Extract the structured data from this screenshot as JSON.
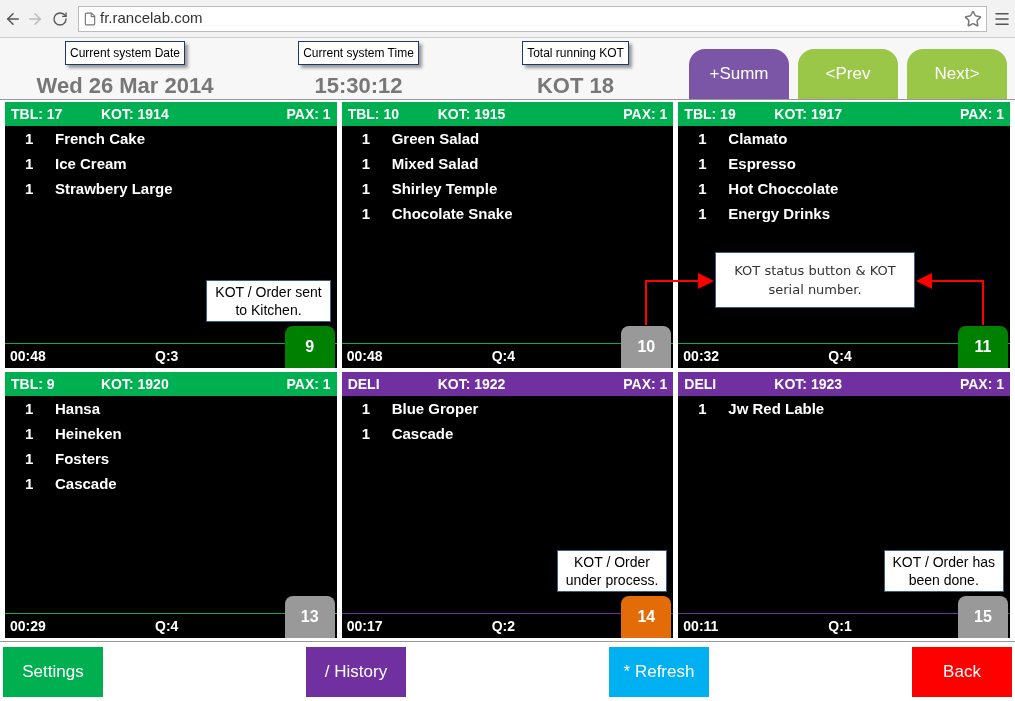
{
  "browser": {
    "url": "fr.rancelab.com"
  },
  "info": [
    {
      "label": "Current system Date",
      "value": "Wed 26 Mar 2014"
    },
    {
      "label": "Current system Time",
      "value": "15:30:12"
    },
    {
      "label": "Total running KOT",
      "value": "KOT 18"
    }
  ],
  "nav_buttons": [
    {
      "label": "+Summ",
      "color": "#7b56a6"
    },
    {
      "label": "<Prev",
      "color": "#9bc748"
    },
    {
      "label": "Next>",
      "color": "#9bc748"
    }
  ],
  "cards": [
    {
      "table": "TBL: 17",
      "kot": "KOT: 1914",
      "pax": "PAX: 1",
      "color": "#00b050",
      "items": [
        {
          "qty": "1",
          "name": "French Cake"
        },
        {
          "qty": "1",
          "name": "Ice Cream"
        },
        {
          "qty": "1",
          "name": "Strawbery Large"
        }
      ],
      "time": "00:48",
      "quantity": "Q:3",
      "status": {
        "serial": "9",
        "color": "#008000"
      },
      "note": [
        "KOT / Order sent",
        "to Kitchen."
      ]
    },
    {
      "table": "TBL: 10",
      "kot": "KOT: 1915",
      "pax": "PAX: 1",
      "color": "#00b050",
      "items": [
        {
          "qty": "1",
          "name": "Green Salad"
        },
        {
          "qty": "1",
          "name": "Mixed Salad"
        },
        {
          "qty": "1",
          "name": "Shirley Temple"
        },
        {
          "qty": "1",
          "name": "Chocolate Snake"
        }
      ],
      "time": "00:48",
      "quantity": "Q:4",
      "status": {
        "serial": "10",
        "color": "#999999"
      }
    },
    {
      "table": "TBL: 19",
      "kot": "KOT: 1917",
      "pax": "PAX: 1",
      "color": "#00b050",
      "items": [
        {
          "qty": "1",
          "name": "Clamato"
        },
        {
          "qty": "1",
          "name": "Espresso"
        },
        {
          "qty": "1",
          "name": "Hot Choccolate"
        },
        {
          "qty": "1",
          "name": "Energy Drinks"
        }
      ],
      "time": "00:32",
      "quantity": "Q:4",
      "status": {
        "serial": "11",
        "color": "#008000"
      }
    },
    {
      "table": "TBL: 9",
      "kot": "KOT: 1920",
      "pax": "PAX: 1",
      "color": "#00b050",
      "items": [
        {
          "qty": "1",
          "name": "Hansa"
        },
        {
          "qty": "1",
          "name": "Heineken"
        },
        {
          "qty": "1",
          "name": "Fosters"
        },
        {
          "qty": "1",
          "name": "Cascade"
        }
      ],
      "time": "00:29",
      "quantity": "Q:4",
      "status": {
        "serial": "13",
        "color": "#999999"
      }
    },
    {
      "table": "DELI",
      "kot": "KOT: 1922",
      "pax": "PAX: 1",
      "color": "#7030a0",
      "items": [
        {
          "qty": "1",
          "name": "Blue Groper"
        },
        {
          "qty": "1",
          "name": "Cascade"
        }
      ],
      "time": "00:17",
      "quantity": "Q:2",
      "status": {
        "serial": "14",
        "color": "#e36c09"
      },
      "note": [
        "KOT / Order",
        "under process."
      ]
    },
    {
      "table": "DELI",
      "kot": "KOT: 1923",
      "pax": "PAX: 1",
      "color": "#7030a0",
      "items": [
        {
          "qty": "1",
          "name": "Jw Red Lable"
        }
      ],
      "time": "00:11",
      "quantity": "Q:1",
      "status": {
        "serial": "15",
        "color": "#999999"
      },
      "note": [
        "KOT / Order has",
        "been done."
      ]
    }
  ],
  "callout": "KOT status button & KOT serial number.",
  "footer_buttons": [
    {
      "label": "Settings",
      "color": "#00b050"
    },
    {
      "label": "/ History",
      "color": "#7030a0"
    },
    {
      "label": "* Refresh",
      "color": "#00b0f0"
    },
    {
      "label": "Back",
      "color": "#ff0000"
    }
  ]
}
